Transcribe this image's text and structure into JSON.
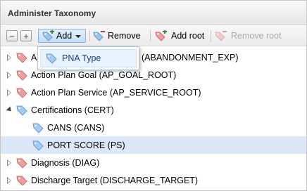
{
  "panel": {
    "title": "Administer Taxonomy"
  },
  "toolbar": {
    "collapse_symbol": "−",
    "expand_symbol": "+",
    "add_label": "Add",
    "remove_label": "Remove",
    "add_root_label": "Add root",
    "remove_root_label": "Remove root"
  },
  "dropdown": {
    "items": [
      {
        "label": "PNA Type"
      }
    ]
  },
  "tree": {
    "rows": [
      {
        "label": "A",
        "label_tail": "(ABANDONMENT_EXP)",
        "tag_color": "red",
        "expander": "collapsed"
      },
      {
        "label": "Action Plan Goal (AP_GOAL_ROOT)",
        "tag_color": "red",
        "expander": "collapsed"
      },
      {
        "label": "Action Plan Service (AP_SERVICE_ROOT)",
        "tag_color": "red",
        "expander": "collapsed"
      },
      {
        "label": "Certifications (CERT)",
        "tag_color": "blue",
        "expander": "expanded"
      },
      {
        "label": "CANS (CANS)",
        "tag_color": "blue",
        "expander": "none"
      },
      {
        "label": "PORT SCORE (PS)",
        "tag_color": "blue",
        "expander": "none",
        "selected": true
      },
      {
        "label": "Diagnosis (DIAG)",
        "tag_color": "red",
        "expander": "collapsed"
      },
      {
        "label": "Discharge Target (DISCHARGE_TARGET)",
        "tag_color": "red",
        "expander": "collapsed"
      }
    ]
  },
  "colors": {
    "selected_row": "#dce8f8",
    "tag_blue": "#8fb8e6",
    "tag_red": "#e88b8b",
    "link": "#1a3f8c"
  },
  "icons": {
    "tag": "tag-icon",
    "tag_add": "tag-add-icon",
    "tag_remove": "tag-remove-icon"
  }
}
